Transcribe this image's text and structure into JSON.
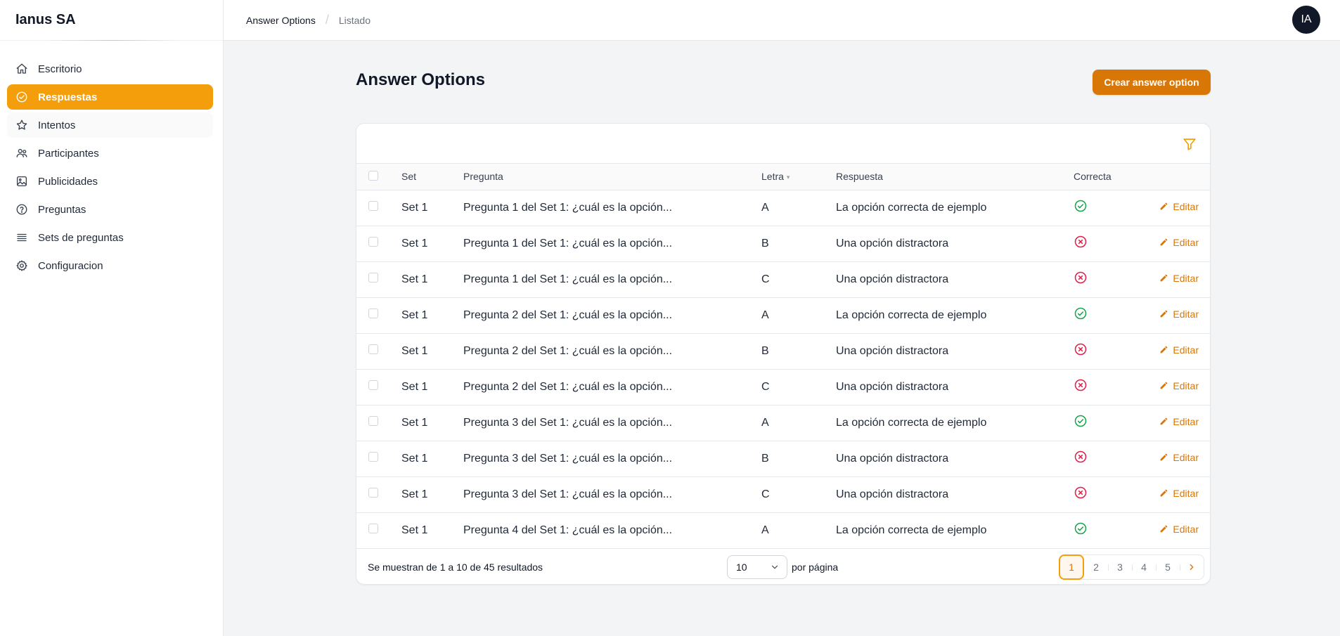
{
  "app": {
    "name": "Ianus SA",
    "avatar_initials": "IA"
  },
  "breadcrumb": {
    "section": "Answer Options",
    "current": "Listado"
  },
  "sidebar": {
    "items": [
      {
        "label": "Escritorio",
        "icon": "home-icon"
      },
      {
        "label": "Respuestas",
        "icon": "check-circle-icon",
        "active": true
      },
      {
        "label": "Intentos",
        "icon": "star-icon"
      },
      {
        "label": "Participantes",
        "icon": "users-icon"
      },
      {
        "label": "Publicidades",
        "icon": "image-icon"
      },
      {
        "label": "Preguntas",
        "icon": "question-circle-icon"
      },
      {
        "label": "Sets de preguntas",
        "icon": "list-icon"
      },
      {
        "label": "Configuracion",
        "icon": "gear-icon"
      }
    ]
  },
  "page": {
    "title": "Answer Options",
    "create_label": "Crear answer option"
  },
  "table": {
    "columns": {
      "set": "Set",
      "pregunta": "Pregunta",
      "letra": "Letra",
      "respuesta": "Respuesta",
      "correcta": "Correcta"
    },
    "edit_label": "Editar",
    "rows": [
      {
        "set": "Set 1",
        "pregunta": "Pregunta 1 del Set 1: ¿cuál es la opción...",
        "letra": "A",
        "respuesta": "La opción correcta de ejemplo",
        "correcta": true
      },
      {
        "set": "Set 1",
        "pregunta": "Pregunta 1 del Set 1: ¿cuál es la opción...",
        "letra": "B",
        "respuesta": "Una opción distractora",
        "correcta": false
      },
      {
        "set": "Set 1",
        "pregunta": "Pregunta 1 del Set 1: ¿cuál es la opción...",
        "letra": "C",
        "respuesta": "Una opción distractora",
        "correcta": false
      },
      {
        "set": "Set 1",
        "pregunta": "Pregunta 2 del Set 1: ¿cuál es la opción...",
        "letra": "A",
        "respuesta": "La opción correcta de ejemplo",
        "correcta": true
      },
      {
        "set": "Set 1",
        "pregunta": "Pregunta 2 del Set 1: ¿cuál es la opción...",
        "letra": "B",
        "respuesta": "Una opción distractora",
        "correcta": false
      },
      {
        "set": "Set 1",
        "pregunta": "Pregunta 2 del Set 1: ¿cuál es la opción...",
        "letra": "C",
        "respuesta": "Una opción distractora",
        "correcta": false
      },
      {
        "set": "Set 1",
        "pregunta": "Pregunta 3 del Set 1: ¿cuál es la opción...",
        "letra": "A",
        "respuesta": "La opción correcta de ejemplo",
        "correcta": true
      },
      {
        "set": "Set 1",
        "pregunta": "Pregunta 3 del Set 1: ¿cuál es la opción...",
        "letra": "B",
        "respuesta": "Una opción distractora",
        "correcta": false
      },
      {
        "set": "Set 1",
        "pregunta": "Pregunta 3 del Set 1: ¿cuál es la opción...",
        "letra": "C",
        "respuesta": "Una opción distractora",
        "correcta": false
      },
      {
        "set": "Set 1",
        "pregunta": "Pregunta 4 del Set 1: ¿cuál es la opción...",
        "letra": "A",
        "respuesta": "La opción correcta de ejemplo",
        "correcta": true
      }
    ]
  },
  "footer": {
    "results_text": "Se muestran de 1 a 10 de 45 resultados",
    "per_page_value": "10",
    "per_page_label": "por página",
    "pages": [
      "1",
      "2",
      "3",
      "4",
      "5"
    ],
    "current_page": "1"
  },
  "colors": {
    "accent": "#f59e0b",
    "accent_dark": "#d97706",
    "success": "#16a34a",
    "danger": "#e11d48"
  }
}
